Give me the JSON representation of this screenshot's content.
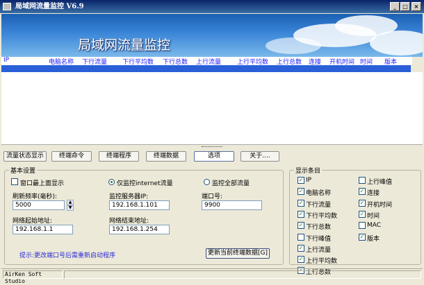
{
  "window": {
    "title": "局域网流量监控 V6.9",
    "minimize": "_",
    "maximize": "□",
    "close": "×"
  },
  "banner": {
    "title": "局域网流量监控"
  },
  "list": {
    "columns": [
      "IP",
      "电脑名称",
      "下行流量",
      "下行平均数",
      "下行总数",
      "上行流量",
      "上行平均数",
      "上行总数",
      "连接",
      "开机时间",
      "时间",
      "版本"
    ]
  },
  "tabs": [
    "流量状态显示",
    "终端命令",
    "终端程序",
    "终端数据",
    "选项",
    "关于...."
  ],
  "basic": {
    "legend": "基本设置",
    "topmost_label": "窗口最上面显示",
    "radio_internet": "仅监控internet流量",
    "radio_all": "监控全部流量",
    "refresh_label": "刷新频率(毫秒):",
    "refresh_value": "5000",
    "server_ip_label": "监控服务器IP:",
    "server_ip_value": "192.168.1.101",
    "port_label": "端口号:",
    "port_value": "9900",
    "start_label": "网络起始地址:",
    "start_value": "192.168.1.1",
    "end_label": "网络结束地址:",
    "end_value": "192.168.1.254",
    "hint": "提示:更改端口号后需重新启动程序",
    "update_button": "更新当前终端数据[G]"
  },
  "display": {
    "legend": "显示条目",
    "items": [
      {
        "label": "IP",
        "checked": true
      },
      {
        "label": "电脑名称",
        "checked": true
      },
      {
        "label": "下行流量",
        "checked": true
      },
      {
        "label": "下行平均数",
        "checked": true
      },
      {
        "label": "下行总数",
        "checked": true
      },
      {
        "label": "下行峰值",
        "checked": false
      },
      {
        "label": "上行流量",
        "checked": true
      },
      {
        "label": "上行平均数",
        "checked": true
      },
      {
        "label": "上行总数",
        "checked": true
      },
      {
        "label": "上行峰值",
        "checked": false
      },
      {
        "label": "连接",
        "checked": true
      },
      {
        "label": "开机时间",
        "checked": true
      },
      {
        "label": "时间",
        "checked": true
      },
      {
        "label": "MAC",
        "checked": false
      },
      {
        "label": "版本",
        "checked": true
      }
    ],
    "check_mark": "✓"
  },
  "status": {
    "left": "AirKen Soft Studio"
  }
}
